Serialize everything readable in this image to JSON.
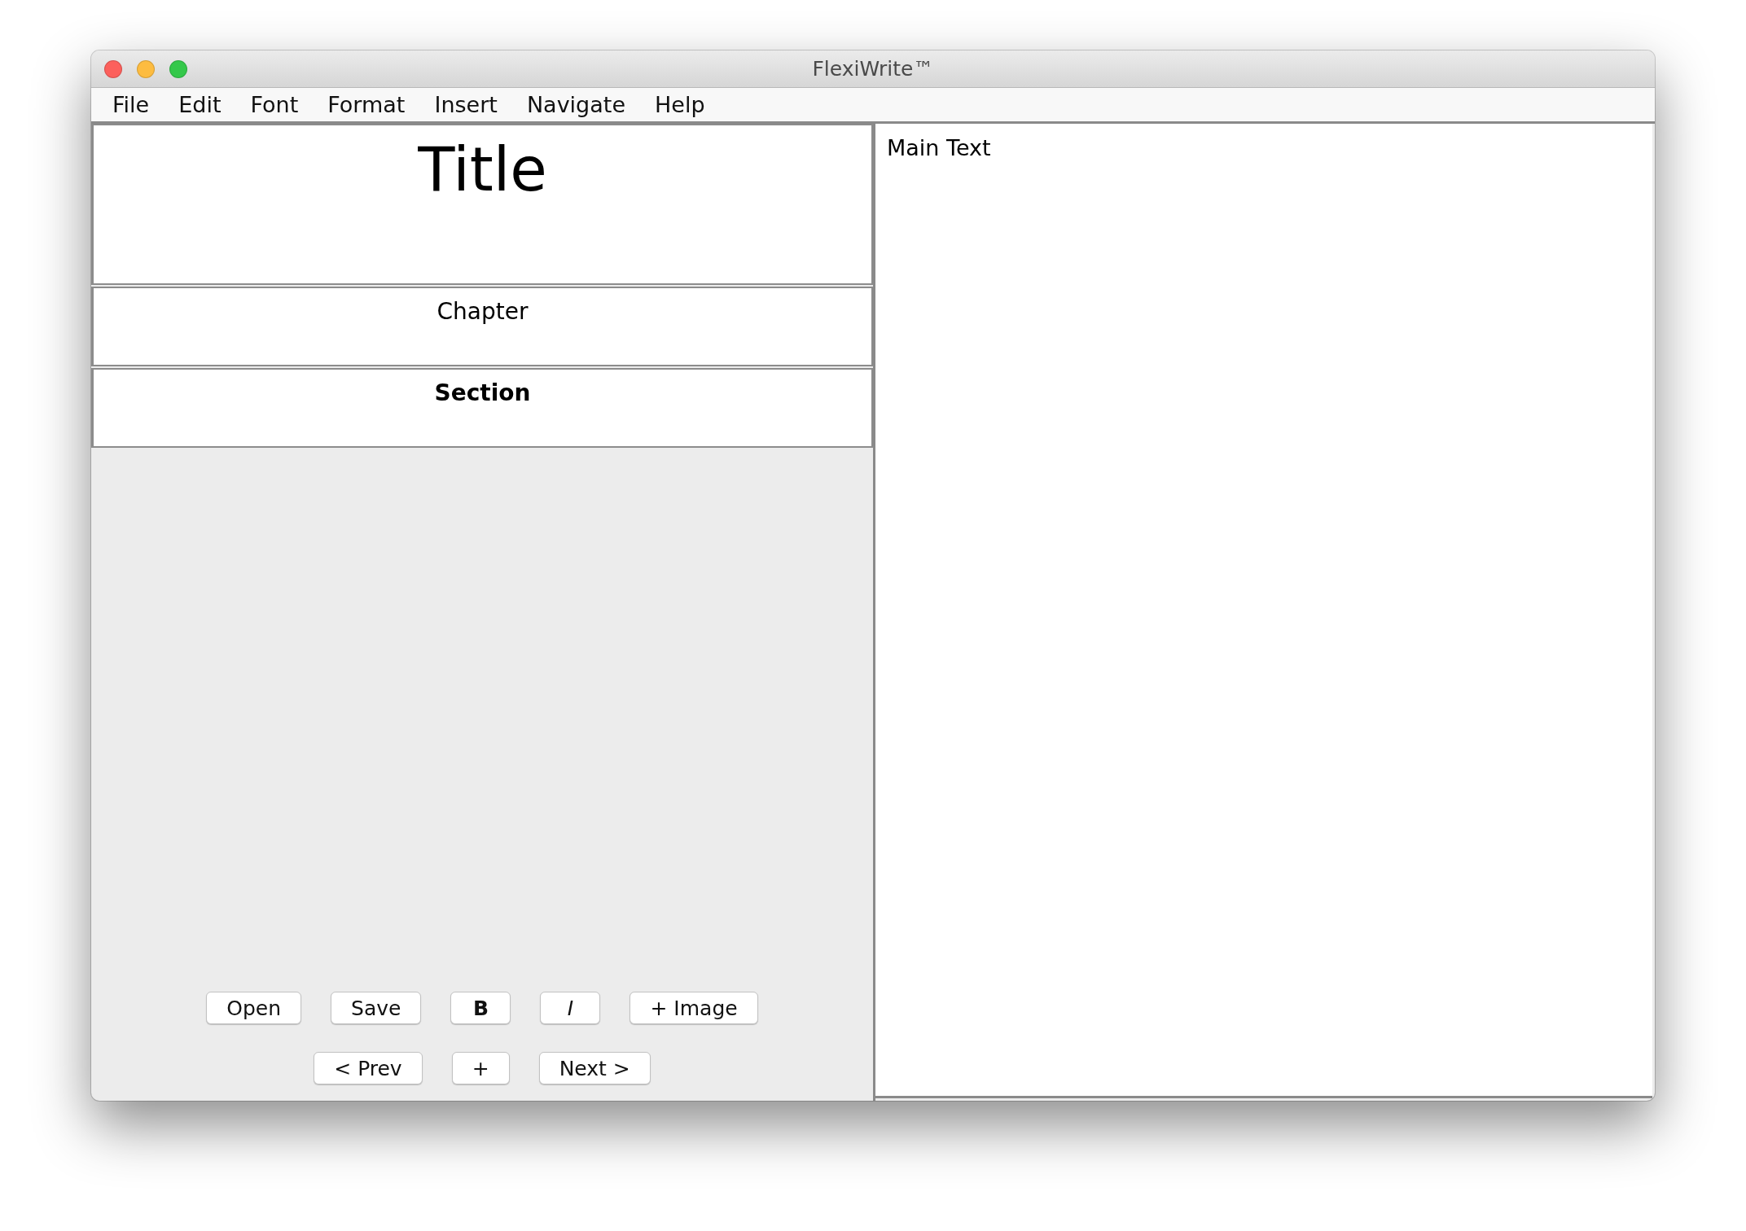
{
  "window": {
    "title": "FlexiWrite™"
  },
  "menu": [
    "File",
    "Edit",
    "Font",
    "Format",
    "Insert",
    "Navigate",
    "Help"
  ],
  "fields": [
    {
      "kind": "title",
      "text": "Title"
    },
    {
      "kind": "chapter",
      "text": "Chapter"
    },
    {
      "kind": "section",
      "text": "Section"
    }
  ],
  "main_text": {
    "text": "Main Text"
  },
  "button_rows": [
    [
      {
        "label": "Open",
        "kind": "plain"
      },
      {
        "label": "Save",
        "kind": "plain"
      },
      {
        "label": "B",
        "kind": "bold"
      },
      {
        "label": "I",
        "kind": "italic"
      },
      {
        "label": "+ Image",
        "kind": "plain"
      }
    ],
    [
      {
        "label": "< Prev",
        "kind": "plain"
      },
      {
        "label": "+",
        "kind": "plain"
      },
      {
        "label": "Next >",
        "kind": "plain"
      }
    ]
  ]
}
